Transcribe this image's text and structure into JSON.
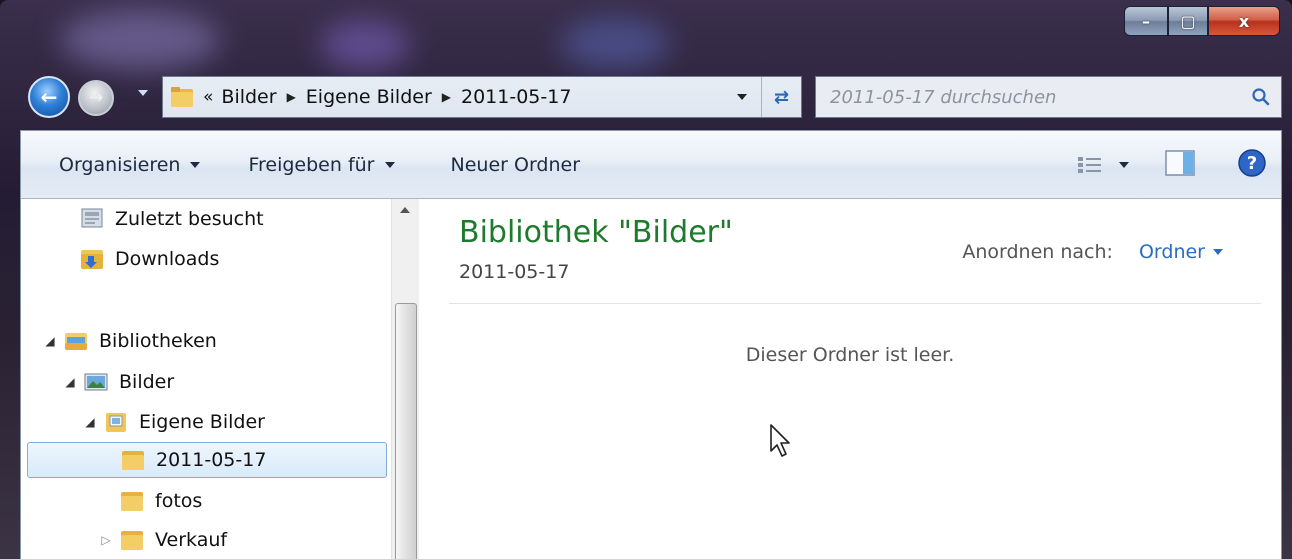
{
  "window": {
    "caption_buttons": {
      "minimize": "–",
      "maximize": "▢",
      "close": "x"
    }
  },
  "nav": {
    "back_icon": "back-arrow-icon",
    "forward_icon": "forward-arrow-icon",
    "breadcrumb_overflow": "«",
    "breadcrumbs": [
      "Bilder",
      "Eigene Bilder",
      "2011-05-17"
    ],
    "search_placeholder": "2011-05-17 durchsuchen"
  },
  "toolbar": {
    "organize": "Organisieren",
    "share": "Freigeben für",
    "new_folder": "Neuer Ordner"
  },
  "sidebar": {
    "items": [
      {
        "label": "Zuletzt besucht",
        "icon": "recent-places-icon"
      },
      {
        "label": "Downloads",
        "icon": "downloads-folder-icon"
      },
      {
        "label": "Bibliotheken",
        "icon": "libraries-icon",
        "expander": "▲"
      },
      {
        "label": "Bilder",
        "icon": "pictures-library-icon",
        "expander": "▲"
      },
      {
        "label": "Eigene Bilder",
        "icon": "my-pictures-icon",
        "expander": "▲"
      },
      {
        "label": "2011-05-17",
        "icon": "folder-icon",
        "selected": true
      },
      {
        "label": "fotos",
        "icon": "folder-icon"
      },
      {
        "label": "Verkauf",
        "icon": "folder-icon",
        "expander": "▷"
      }
    ]
  },
  "content": {
    "title": "Bibliothek \"Bilder\"",
    "subtitle": "2011-05-17",
    "arrange_label": "Anordnen nach:",
    "arrange_value": "Ordner",
    "empty_message": "Dieser Ordner ist leer."
  },
  "colors": {
    "title_green": "#1e7a2c",
    "link_blue": "#2a6cc0",
    "selection_border": "#84acdd"
  }
}
